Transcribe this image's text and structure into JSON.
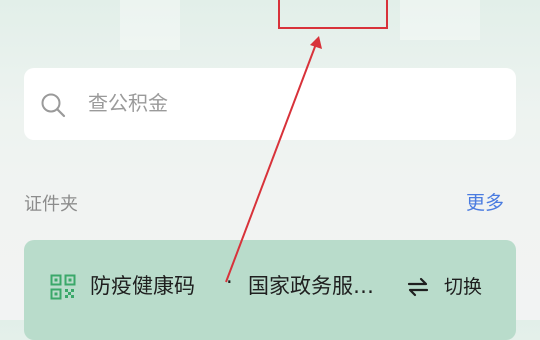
{
  "search": {
    "placeholder": "查公积金"
  },
  "section": {
    "title": "证件夹",
    "more_label": "更多"
  },
  "card": {
    "title": "防疫健康码",
    "separator": "·",
    "subtitle": "国家政务服…",
    "switch_label": "切换"
  },
  "colors": {
    "accent_blue": "#4a7be0",
    "card_green": "#b9dccb",
    "icon_green": "#3aa86a",
    "annotation_red": "#d8323a"
  },
  "icons": [
    "search-icon",
    "qr-code-icon",
    "switch-arrows-icon"
  ]
}
